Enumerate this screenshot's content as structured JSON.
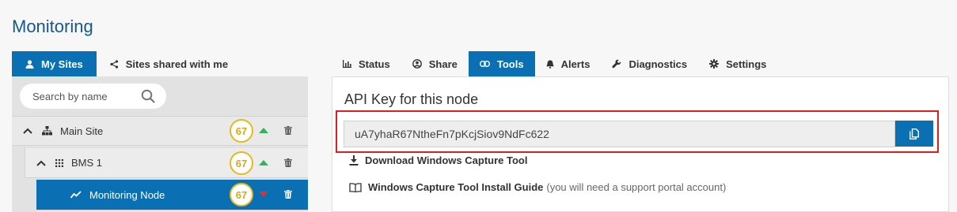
{
  "page": {
    "title": "Monitoring"
  },
  "left_tabs": [
    {
      "label": "My Sites",
      "icon": "user-icon",
      "active": true
    },
    {
      "label": "Sites shared with me",
      "icon": "share-icon",
      "active": false
    }
  ],
  "search": {
    "placeholder": "Search by name"
  },
  "tree": [
    {
      "label": "Main Site",
      "icon": "sitemap-icon",
      "score": "67",
      "trend": "up"
    },
    {
      "label": "BMS 1",
      "icon": "grid-icon",
      "score": "67",
      "trend": "up"
    },
    {
      "label": "Monitoring Node",
      "icon": "chart-line-icon",
      "score": "67",
      "trend": "down",
      "selected": true
    }
  ],
  "right_tabs": [
    {
      "label": "Status",
      "icon": "bar-chart-icon"
    },
    {
      "label": "Share",
      "icon": "user-circle-icon"
    },
    {
      "label": "Tools",
      "icon": "link-icon",
      "active": true
    },
    {
      "label": "Alerts",
      "icon": "bell-icon"
    },
    {
      "label": "Diagnostics",
      "icon": "wrench-icon"
    },
    {
      "label": "Settings",
      "icon": "gear-icon"
    }
  ],
  "tools": {
    "api_title": "API Key for this node",
    "api_key": "uA7yhaR67NtheFn7pKcjSiov9NdFc622",
    "download_label": "Download Windows Capture Tool",
    "guide_label": "Windows Capture Tool Install Guide",
    "guide_note": "(you will need a support portal account)"
  },
  "colors": {
    "accent": "#0a6fb3",
    "title": "#15588f",
    "score_ring": "#e5b821",
    "trend_up": "#2fb55a",
    "trend_down": "#e0312f",
    "highlight": "#e01e1e"
  }
}
